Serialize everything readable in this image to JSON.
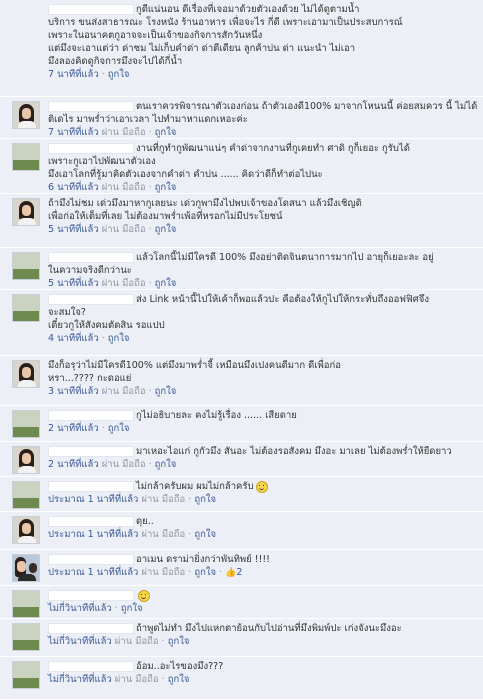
{
  "comments": [
    {
      "lines": [
        "กูดีแน่นอน ดีเรื่องที่เจอมาด้วยตัวเองด้วย ไม่ได้ดูตามน้ำ",
        "บริการ ขนส่งสาธารณะ โรงหนัง ร้านอาหาร เพื่อจะไร กี่ดี เพราะเอามาเป็นประสบการณ์",
        "เพราะในอนาคตกูอาจจะเป็นเจ้าของกิจการสักวันหนึ่ง",
        "แต่มึงจะเอาแต่ว่า ด่าชม ไม่เก็บคำด่า ด่าตีเดียน ลูกค้าบ่น ด่า แนะนำ ไม่เอา",
        "มึงลองคิดดูกิจการมึงจะไปได้กี่น้ำ"
      ],
      "meta": {
        "time": "7 นาทีที่แล้ว",
        "mobile": "",
        "like": "ถูกใจ",
        "like_count": ""
      }
    },
    {
      "lines": [
        "ตนเราควรพิจารณาตัวเองก่อน ถ้าตัวเองดี100% มาจากโหนนนี้ ค่อยสมควร นี้ ไม่ได้",
        "ติเดไร มาพร่ำว่าเอาเวลา ไปทำมาหาแดกเหอะค่ะ"
      ],
      "meta": {
        "time": "7 นาทีที่แล้ว",
        "mobile": "ผ่าน มือถือ",
        "like": "ถูกใจ",
        "like_count": ""
      }
    },
    {
      "lines": [
        "งานที่กูทำกูพัฒนาแน่ๆ คำด่าจากงานที่กูเคยทำ ศาดิ กูก็เยอะ กูรับได้",
        "เพราะกูเอาไปพัฒนาตัวเอง",
        "มึงเอาโลกที่รู้มาคิดตัวเองจากคำด่า คำบ่น ...... คิดว่าดีก็ทำต่อไปนะ"
      ],
      "meta": {
        "time": "6 นาทีที่แล้ว",
        "mobile": "ผ่าน มือถือ",
        "like": "ถูกใจ",
        "like_count": ""
      }
    },
    {
      "lines": [
        "ถ้ามึงไม่ชม เด่วมึงมาหากูเลยนะ เด่วกูพามึงไปพบเจ้าของโดสนา แล้วมึงเชิญดิ",
        "เพื่อก่อให้เต็มที่เลย ไม่ต้องมาพร่ำเพ้อที่หรอกไม่มีประโยชน์"
      ],
      "meta": {
        "time": "5 นาทีที่แล้ว",
        "mobile": "ผ่าน มือถือ",
        "like": "ถูกใจ",
        "like_count": ""
      }
    },
    {
      "lines": [
        "แล้วโลกนี้ไม่มีใครดี 100% มึงอย่าติดจินตนาการมากไป อายุก็เยอะละ อยู่",
        "ในความจริงดีกว่านะ"
      ],
      "meta": {
        "time": "5 นาทีที่แล้ว",
        "mobile": "ผ่าน มือถือ",
        "like": "ถูกใจ",
        "like_count": ""
      }
    },
    {
      "lines": [
        "ส่ง Link หน้านี้ไปให้เค้าก็พอแล้วปะ คือต้องให้กูไปให้กระทั่บถึงออฟฟิศจึง",
        "จะสมใจ?",
        "เดี๋ยวกูให้สังคมตัดสิน รอแปป"
      ],
      "meta": {
        "time": "4 นาทีที่แล้ว",
        "mobile": "",
        "like": "ถูกใจ",
        "like_count": ""
      }
    },
    {
      "lines": [
        "มึงก็อรุว่าไม่มีใครดี100% แต่มึงมาพร่ำจี้ เหมือนมึงเปงคนดีมาก ดีเพื่อก่อ",
        "หรา...???? กะดอแย่"
      ],
      "meta": {
        "time": "3 นาทีที่แล้ว",
        "mobile": "ผ่าน มือถือ",
        "like": "ถูกใจ",
        "like_count": ""
      }
    },
    {
      "lines": [
        "กูไม่อธิบายละ คงไม่รู้เรื่อง ...... เสียดาย"
      ],
      "meta": {
        "time": "2 นาทีที่แล้ว",
        "mobile": "",
        "like": "ถูกใจ",
        "like_count": ""
      }
    },
    {
      "lines": [
        "มาเหอะไอแก่ กูกัวมึง สันอะ ไม่ต้องรอสังคม มึงอะ มาเลย ไม่ต้องพร่ำให้ยืดยาว"
      ],
      "meta": {
        "time": "2 นาทีที่แล้ว",
        "mobile": "ผ่าน มือถือ",
        "like": "ถูกใจ",
        "like_count": ""
      }
    },
    {
      "lines": [
        "ไม่กล้าครับผม ผมไม่กล้าครับ"
      ],
      "meta": {
        "time": "ประมาณ 1 นาทีที่แล้ว",
        "mobile": "ผ่าน มือถือ",
        "like": "ถูกใจ",
        "like_count": ""
      }
    },
    {
      "lines": [
        "ดุย.."
      ],
      "meta": {
        "time": "ประมาณ 1 นาทีที่แล้ว",
        "mobile": "ผ่าน มือถือ",
        "like": "ถูกใจ",
        "like_count": ""
      }
    },
    {
      "lines": [
        "อาเมน ดราม่ายิ่งกว่าพันทิพย์ !!!!"
      ],
      "meta": {
        "time": "ประมาณ 1 นาทีที่แล้ว",
        "mobile": "ผ่าน มือถือ",
        "like": "ถูกใจ",
        "like_count": "2"
      }
    },
    {
      "lines": [
        ""
      ],
      "meta": {
        "time": "ไม่กี่วินาทีที่แล้ว",
        "mobile": "",
        "like": "ถูกใจ",
        "like_count": ""
      }
    },
    {
      "lines": [
        "ถ้าพูดไม่ทำ มึงไปแหกตาย้อนกับไปอ่านที่มึงพิมพ์ปะ เก่งจังนะมึงอะ"
      ],
      "meta": {
        "time": "ไม่กี่วินาทีที่แล้ว",
        "mobile": "ผ่าน มือถือ",
        "like": "ถูกใจ",
        "like_count": ""
      }
    },
    {
      "lines": [
        "อ้อม..อะไรของมึง???"
      ],
      "meta": {
        "time": "ไม่กี่วินาทีที่แล้ว",
        "mobile": "ผ่าน มือถือ",
        "like": "ถูกใจ",
        "like_count": ""
      }
    }
  ]
}
